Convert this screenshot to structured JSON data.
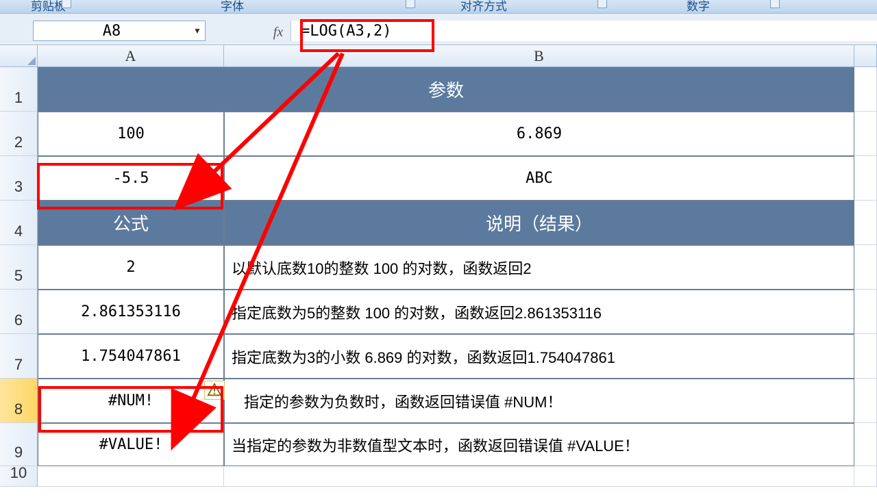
{
  "ribbon": {
    "clipboard": "剪贴板",
    "font": "字体",
    "alignment": "对齐方式",
    "number": "数字"
  },
  "name_box": "A8",
  "fx_label": "fx",
  "formula": "=LOG(A3,2)",
  "columns": {
    "A": "A",
    "B": "B"
  },
  "rows": [
    "1",
    "2",
    "3",
    "4",
    "5",
    "6",
    "7",
    "8",
    "9",
    "10"
  ],
  "cells": {
    "r1": {
      "merged": "参数"
    },
    "r2": {
      "A": "100",
      "B": "6.869"
    },
    "r3": {
      "A": "-5.5",
      "B": "ABC"
    },
    "r4": {
      "A": "公式",
      "B": "说明（结果）"
    },
    "r5": {
      "A": "2",
      "B": "以默认底数10的整数 100 的对数，函数返回2"
    },
    "r6": {
      "A": "2.861353116",
      "B": "指定底数为5的整数 100 的对数，函数返回2.861353116"
    },
    "r7": {
      "A": "1.754047861",
      "B": "指定底数为3的小数 6.869 的对数，函数返回1.754047861"
    },
    "r8": {
      "A": "#NUM!",
      "B": "指定的参数为负数时，函数返回错误值 #NUM！"
    },
    "r9": {
      "A": "#VALUE!",
      "B": "当指定的参数为非数值型文本时，函数返回错误值 #VALUE！"
    }
  },
  "colors": {
    "header_bg": "#5c7a9e",
    "highlight": "#ff0000"
  }
}
